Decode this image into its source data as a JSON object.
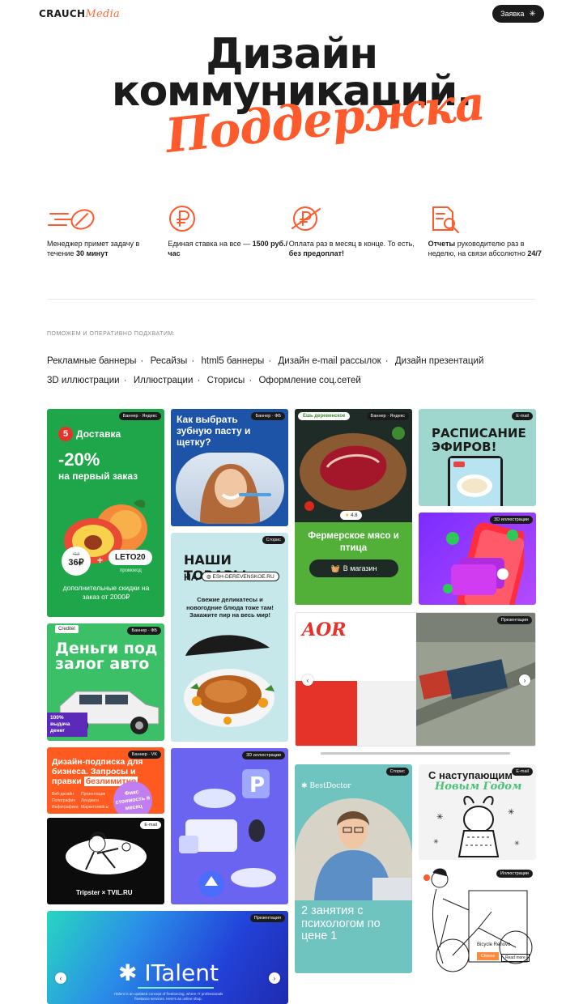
{
  "header": {
    "logo_word": "CRAUCH",
    "logo_script": "Media",
    "request_button": "Заявка"
  },
  "hero": {
    "line1": "Дизайн",
    "line2": "коммуникаций.",
    "script": "Поддержка"
  },
  "features": [
    {
      "icon": "fast-rocket-icon",
      "pre": "Менеджер примет задачу в течение ",
      "bold": "30 минут",
      "post": ""
    },
    {
      "icon": "ruble-coin-icon",
      "pre": "Единая ставка на все — ",
      "bold": "1500 руб./час",
      "post": ""
    },
    {
      "icon": "ruble-coin-slash-icon",
      "pre": "Оплата раз в месяц в конце. То есть, ",
      "bold": "без предоплат!",
      "post": ""
    },
    {
      "icon": "report-magnifier-icon",
      "pre": "",
      "bold": "Отчеты",
      "post": " руководителю раз в неделю, на связи абсолютно ",
      "bold2": "24/7"
    }
  ],
  "services": {
    "label": "ПОМОЖЕМ И ОПЕРАТИВНО ПОДХВАТИМ:",
    "items": [
      "Рекламные баннеры",
      "Ресайзы",
      "html5 баннеры",
      "Дизайн e-mail рассылок",
      "Дизайн презентаций",
      "3D иллюстрации",
      "Иллюстрации",
      "Сторисы",
      "Оформление соц.сетей"
    ]
  },
  "cards": {
    "delivery": {
      "tag": "Баннер · Яндекс",
      "brand": "Доставка",
      "discount": "-20%",
      "subtitle": "на первый заказ",
      "price_old": "41₽",
      "price": "36₽",
      "plus": "+",
      "promo": "LETO20",
      "promo_label": "промокод",
      "footer": "дополнительные скидки на заказ от 2000₽"
    },
    "toothpaste": {
      "tag": "Баннер · ФБ",
      "title": "Как выбрать зубную пасту и щетку?"
    },
    "meat": {
      "tag": "Баннер · Яндекс",
      "brand": "Ешь деревенское",
      "rating": "4.8",
      "title": "Фермерское мясо и птица",
      "button": "В магазин"
    },
    "schedule": {
      "tag": "E-mail",
      "title": "РАСПИСАНИЕ ЭФИРОВ!"
    },
    "phone3d": {
      "tag": "3D иллюстрации"
    },
    "goods": {
      "tag": "Сторис",
      "title": "НАШИ ТОВАРЫ",
      "na": "НА",
      "url": "ESH-DEREVENSKOE.RU",
      "text": "Свежие деликатесы и новогодние блюда тоже там! Закажите пир на весь мир!"
    },
    "auto": {
      "tag": "Баннер · ФБ",
      "brand": "Creditel",
      "title": "Деньги под залог авто",
      "badge": "100% выдача денег"
    },
    "presentation1": {
      "tag": "Презентация",
      "logo": "AOR",
      "prev": "‹",
      "next": "›"
    },
    "subscription": {
      "tag": "Баннер · VK",
      "title": "Дизайн-подписка для бизнеса. Запросы и правки",
      "highlight": "безлимитно",
      "fix": "Фикс стоимость в месяц",
      "cols": [
        "Веб-дизайн",
        "Презентации",
        "Полиграфия",
        "Лендинги",
        "Инфографика",
        "Маркетплейсы"
      ]
    },
    "tripster": {
      "tag": "E-mail",
      "brand": "Tripster × TVIL.RU"
    },
    "cars3d": {
      "tag": "3D иллюстрации"
    },
    "bestdoctor": {
      "tag": "Сторис",
      "brand": "✱ BestDoctor",
      "title": "2 занятия с психологом по цене 1"
    },
    "newyear": {
      "tag": "E-mail",
      "title": "С наступающим",
      "script": "Новым Годом"
    },
    "bicycle": {
      "tag": "Иллюстрации",
      "label": "Bicycle Renovo",
      "btn1": "Choose",
      "btn2": "Read more"
    },
    "italent": {
      "tag": "Презентация",
      "title": "✱ ITalent",
      "sub": "ITalent is an updated concept of freelancing, where IT professionals freelance services. Here's an online shop.",
      "prev": "‹",
      "next": "›"
    }
  }
}
